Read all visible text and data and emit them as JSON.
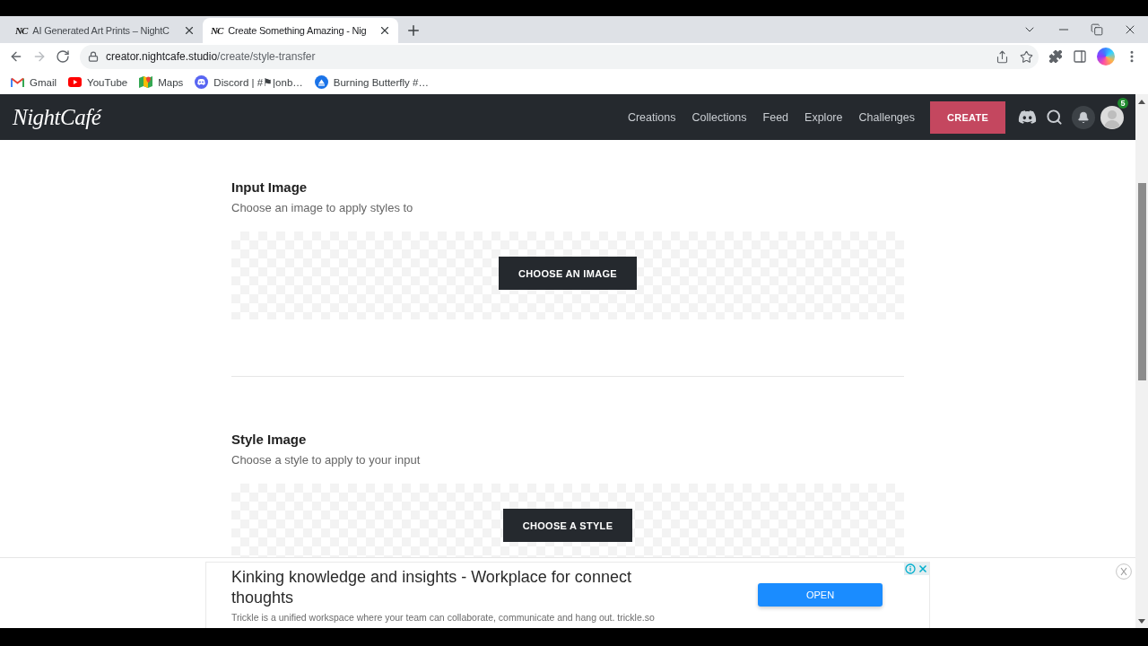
{
  "browser": {
    "tabs": [
      {
        "favicon": "NC",
        "title": "AI Generated Art Prints – NightC",
        "selected": false
      },
      {
        "favicon": "NC",
        "title": "Create Something Amazing - Nig",
        "selected": true
      }
    ],
    "nav_buttons": [
      {
        "kind": "back",
        "disabled": false
      },
      {
        "kind": "forward",
        "disabled": true
      },
      {
        "kind": "reload",
        "disabled": false
      }
    ],
    "address": {
      "host": "creator.nightcafe.studio",
      "path": "/create/style-transfer"
    },
    "bookmarks": [
      {
        "kind": "mail",
        "label": "Gmail"
      },
      {
        "kind": "video",
        "label": "YouTube"
      },
      {
        "kind": "map",
        "label": "Maps"
      },
      {
        "kind": "chat",
        "label": "Discord | #⚑|onb…"
      },
      {
        "kind": "site",
        "label": "Burning Butterfly #…"
      }
    ]
  },
  "site_header": {
    "logo": "NightCafé",
    "nav_links": [
      "Creations",
      "Collections",
      "Feed",
      "Explore",
      "Challenges"
    ],
    "create_button": "CREATE",
    "avatar_badge": "5"
  },
  "sections": [
    {
      "title": "Input Image",
      "subtitle": "Choose an image to apply styles to",
      "button": "CHOOSE AN IMAGE"
    },
    {
      "title": "Style Image",
      "subtitle": "Choose a style to apply to your input",
      "button": "CHOOSE A STYLE"
    }
  ],
  "ad": {
    "headline": "Kinking knowledge and insights - Workplace for connect thoughts",
    "description": "Trickle is a unified workspace where your team can collaborate, communicate and hang out. trickle.so",
    "button": "OPEN"
  }
}
